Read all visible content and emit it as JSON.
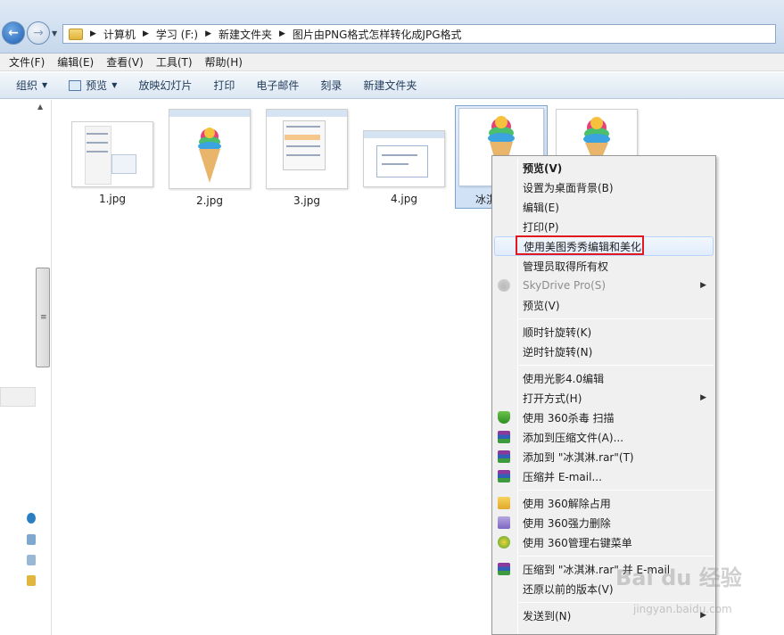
{
  "address": {
    "crumbs": [
      "计算机",
      "学习 (F:)",
      "新建文件夹",
      "图片由PNG格式怎样转化成JPG格式"
    ]
  },
  "menubar": [
    "文件(F)",
    "编辑(E)",
    "查看(V)",
    "工具(T)",
    "帮助(H)"
  ],
  "toolbar": {
    "organize": "组织",
    "preview": "预览",
    "slideshow": "放映幻灯片",
    "print": "打印",
    "email": "电子邮件",
    "burn": "刻录",
    "new_folder": "新建文件夹"
  },
  "files": [
    {
      "name": "1.jpg"
    },
    {
      "name": "2.jpg"
    },
    {
      "name": "3.jpg"
    },
    {
      "name": "4.jpg"
    },
    {
      "name": "冰淇",
      "selected": true
    },
    {
      "name": ""
    }
  ],
  "context_menu": {
    "items": [
      {
        "label": "预览(V)",
        "bold": true
      },
      {
        "label": "设置为桌面背景(B)"
      },
      {
        "label": "编辑(E)"
      },
      {
        "label": "打印(P)"
      },
      {
        "label": "使用美图秀秀编辑和美化",
        "highlighted": true
      },
      {
        "label": "管理员取得所有权"
      },
      {
        "label": "SkyDrive Pro(S)",
        "disabled": true,
        "submenu": true
      },
      {
        "label": "预览(V)"
      },
      {
        "label": "顺时针旋转(K)"
      },
      {
        "label": "逆时针旋转(N)"
      },
      {
        "label": "使用光影4.0编辑"
      },
      {
        "label": "打开方式(H)",
        "submenu": true
      },
      {
        "label": "使用 360杀毒 扫描",
        "icon": "shield-icon"
      },
      {
        "label": "添加到压缩文件(A)...",
        "icon": "winrar-icon"
      },
      {
        "label": "添加到 \"冰淇淋.rar\"(T)",
        "icon": "winrar-icon"
      },
      {
        "label": "压缩并 E-mail...",
        "icon": "winrar-icon"
      },
      {
        "label": "使用 360解除占用",
        "icon": "unlock-icon"
      },
      {
        "label": "使用 360强力删除",
        "icon": "shredder-icon"
      },
      {
        "label": "使用 360管理右键菜单",
        "icon": "plus-circle-icon"
      },
      {
        "label": "压缩到 \"冰淇淋.rar\" 并 E-mail",
        "icon": "winrar-icon"
      },
      {
        "label": "还原以前的版本(V)"
      },
      {
        "label": "发送到(N)",
        "submenu": true
      }
    ]
  },
  "watermark": {
    "text": "Bai du 经验",
    "sub": "jingyan.baidu.com"
  },
  "colors": {
    "highlight_box": "#e3171e",
    "selection": "#cfe0f5"
  }
}
